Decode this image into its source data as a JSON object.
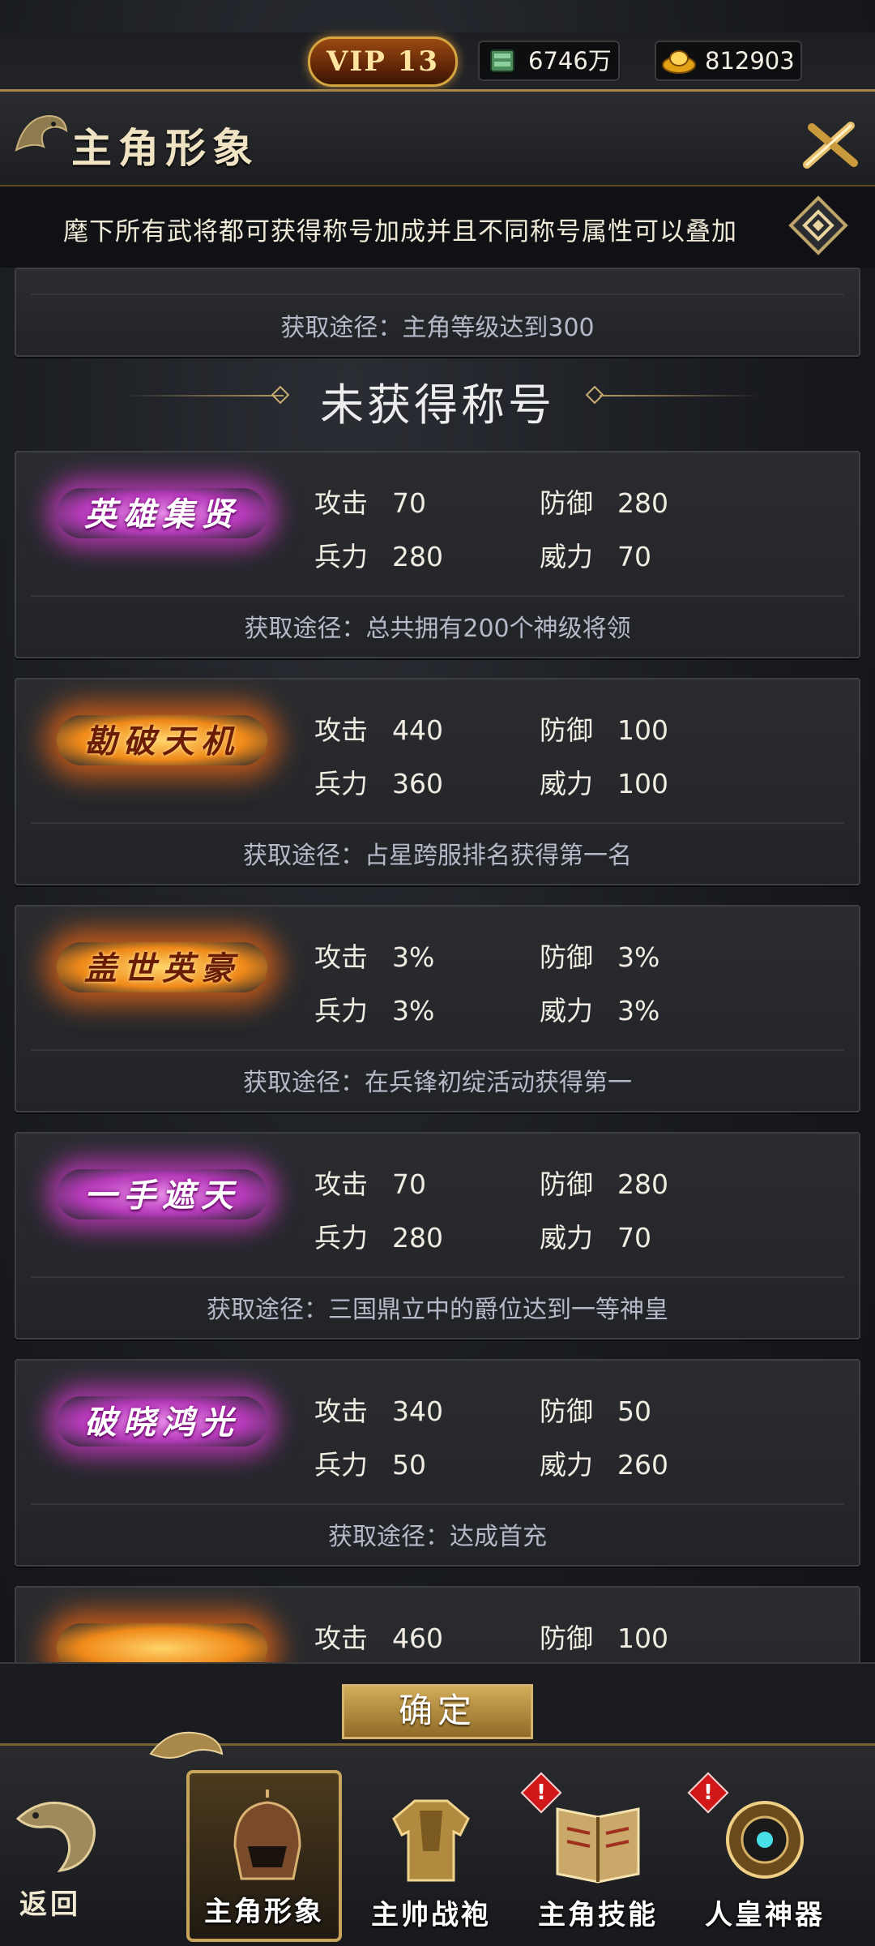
{
  "header": {
    "vip_label": "VIP 13",
    "silver_amount": "6746万",
    "gold_amount": "812903",
    "title": "主角形象"
  },
  "info": {
    "text": "麾下所有武将都可获得称号加成并且不同称号属性可以叠加"
  },
  "prev_card": {
    "way": "获取途径：主角等级达到300"
  },
  "section": {
    "title": "未获得称号"
  },
  "titles": [
    {
      "badge": "英雄集贤",
      "style": "purple",
      "stats": [
        {
          "k": "攻击",
          "v": "70"
        },
        {
          "k": "防御",
          "v": "280"
        },
        {
          "k": "兵力",
          "v": "280"
        },
        {
          "k": "威力",
          "v": "70"
        }
      ],
      "way": "获取途径：总共拥有200个神级将领"
    },
    {
      "badge": "勘破天机",
      "style": "fire",
      "stats": [
        {
          "k": "攻击",
          "v": "440"
        },
        {
          "k": "防御",
          "v": "100"
        },
        {
          "k": "兵力",
          "v": "360"
        },
        {
          "k": "威力",
          "v": "100"
        }
      ],
      "way": "获取途径：占星跨服排名获得第一名"
    },
    {
      "badge": "盖世英豪",
      "style": "fire",
      "stats": [
        {
          "k": "攻击",
          "v": "3%"
        },
        {
          "k": "防御",
          "v": "3%"
        },
        {
          "k": "兵力",
          "v": "3%"
        },
        {
          "k": "威力",
          "v": "3%"
        }
      ],
      "way": "获取途径：在兵锋初绽活动获得第一"
    },
    {
      "badge": "一手遮天",
      "style": "purple",
      "stats": [
        {
          "k": "攻击",
          "v": "70"
        },
        {
          "k": "防御",
          "v": "280"
        },
        {
          "k": "兵力",
          "v": "280"
        },
        {
          "k": "威力",
          "v": "70"
        }
      ],
      "way": "获取途径：三国鼎立中的爵位达到一等神皇"
    },
    {
      "badge": "破晓鸿光",
      "style": "purple",
      "stats": [
        {
          "k": "攻击",
          "v": "340"
        },
        {
          "k": "防御",
          "v": "50"
        },
        {
          "k": "兵力",
          "v": "50"
        },
        {
          "k": "威力",
          "v": "260"
        }
      ],
      "way": "获取途径：达成首充"
    },
    {
      "badge": "",
      "style": "fire",
      "stats": [
        {
          "k": "攻击",
          "v": "460"
        },
        {
          "k": "防御",
          "v": "100"
        }
      ],
      "way": ""
    }
  ],
  "confirm": {
    "label": "确定"
  },
  "nav": {
    "back": "返回",
    "items": [
      {
        "label": "主角形象",
        "icon": "helmet-icon",
        "active": true,
        "alert": false
      },
      {
        "label": "主帅战袍",
        "icon": "armor-icon",
        "active": false,
        "alert": false
      },
      {
        "label": "主角技能",
        "icon": "skill-book-icon",
        "active": false,
        "alert": true
      },
      {
        "label": "人皇神器",
        "icon": "artifact-icon",
        "active": false,
        "alert": true
      }
    ],
    "alert_mark": "!"
  }
}
